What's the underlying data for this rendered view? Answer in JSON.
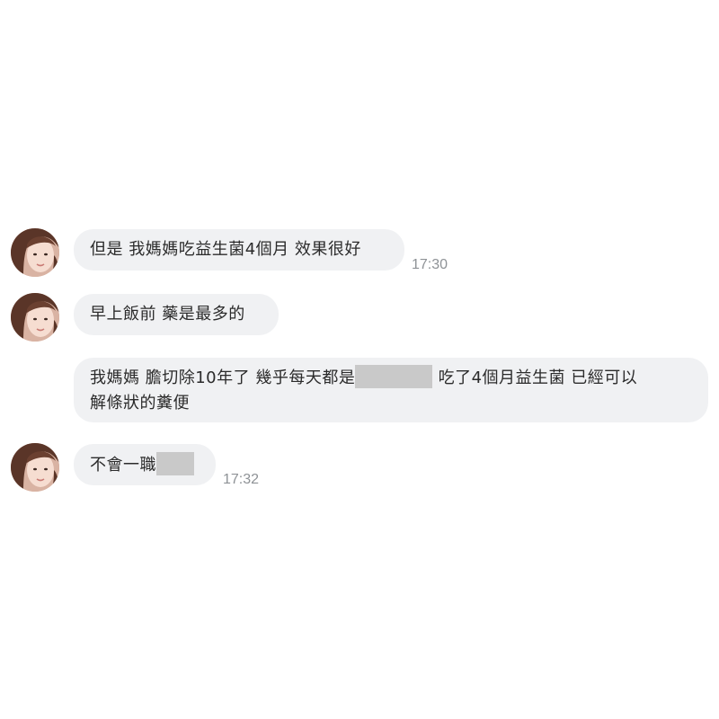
{
  "messages": [
    {
      "sender": "contact",
      "text": "但是 我媽媽吃益生菌4個月  效果很好",
      "time": "17:30",
      "show_avatar": true
    },
    {
      "sender": "contact",
      "text": "早上飯前  藥是最多的",
      "time": "",
      "show_avatar": true
    },
    {
      "sender": "contact",
      "text_parts": [
        "我媽媽 膽切除10年了  幾乎每天都是",
        "[redacted]",
        " 吃了4個月益生菌  已經可以",
        "解條狀的糞便"
      ],
      "time": "",
      "show_avatar": false
    },
    {
      "sender": "contact",
      "text_parts": [
        "不會一職",
        "[redacted]"
      ],
      "time": "17:32",
      "show_avatar": true
    }
  ],
  "colors": {
    "bubble": "#f0f1f3",
    "text": "#2b2b2b",
    "timestamp": "#8e9296",
    "redaction": "#c9c9c9"
  },
  "icons": {
    "avatar": "contact-avatar-photo",
    "redaction": "redaction-block"
  }
}
